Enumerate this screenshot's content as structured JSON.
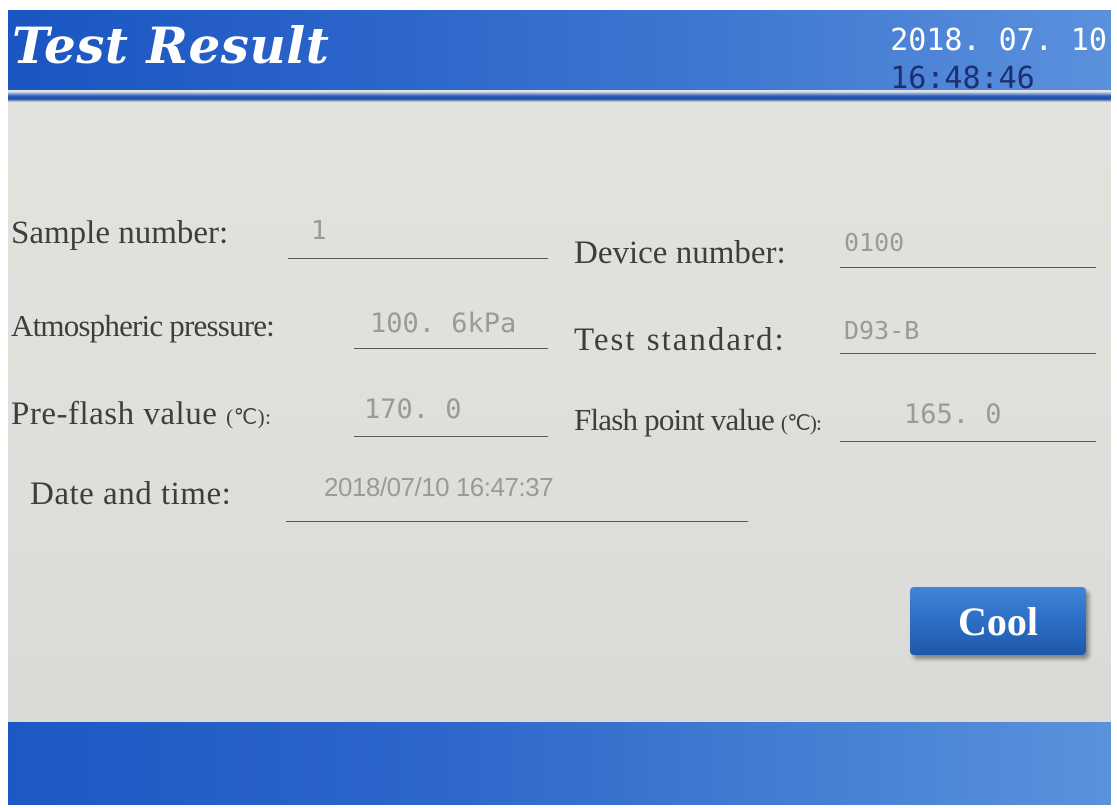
{
  "header": {
    "title": "Test Result",
    "date": "2018. 07. 10",
    "time": "16:48:46"
  },
  "fields": {
    "sample_number": {
      "label": "Sample number:",
      "value": "1"
    },
    "device_number": {
      "label": "Device number:",
      "value": "0100"
    },
    "atmospheric_pressure": {
      "label": "Atmospheric pressure:",
      "value": "100. 6kPa"
    },
    "test_standard": {
      "label": "Test standard:",
      "value": "D93-B"
    },
    "pre_flash_value": {
      "label": "Pre-flash value",
      "unit": "(℃):",
      "value": "170. 0"
    },
    "flash_point_value": {
      "label": "Flash point value",
      "unit": "(℃):",
      "value": "165. 0"
    },
    "date_and_time": {
      "label": "Date and time:",
      "value": "2018/07/10 16:47:37"
    }
  },
  "buttons": {
    "cool_label": "Cool"
  },
  "colors": {
    "header_blue": "#1b55c2",
    "button_blue": "#2a6cc4",
    "panel_bg": "#e2e2de",
    "label_text": "#3e3e3e",
    "value_text": "#9a9a9a"
  }
}
